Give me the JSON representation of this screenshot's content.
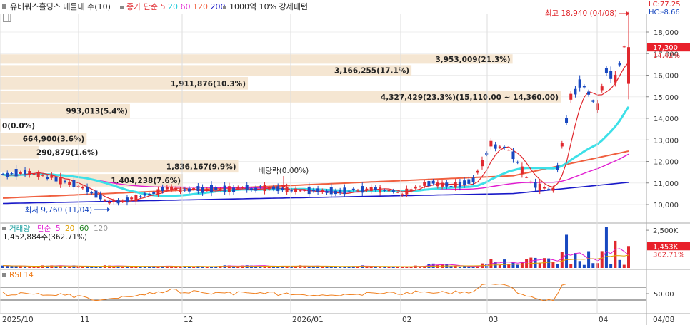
{
  "header": {
    "stock_name": "유비쿼스홀딩스 매물대 수(10)",
    "ma_label": "종가 단순",
    "ma_periods": [
      "5",
      "20",
      "60",
      "120",
      "200"
    ],
    "ma_colors": [
      "#e0282e",
      "#1ec9d8",
      "#e01ad0",
      "#f06040",
      "#1818c8"
    ],
    "volume_profile_label": "1000억 10% 강세패턴",
    "lc": "LC:77.25",
    "hc": "HC:-8.66"
  },
  "price_panel": {
    "high_label": "최고 18,940 (04/08)",
    "low_label": "최저 9,760 (11/04)",
    "dividend_label": "배당락(0.00%)",
    "last_price": "17,300",
    "last_change": "14.42%",
    "y_ticks": [
      "18,000",
      "17,000",
      "16,000",
      "15,000",
      "14,000",
      "13,000",
      "12,000",
      "11,000",
      "10,000"
    ]
  },
  "volume_profile": [
    {
      "label": "3,953,009(21.3%)",
      "low": 16500,
      "high": 17000,
      "pct": 21.3
    },
    {
      "label": "3,166,255(17.1%)",
      "low": 15950,
      "high": 16500,
      "pct": 17.1
    },
    {
      "label": "1,911,876(10.3%)",
      "low": 15300,
      "high": 15950,
      "pct": 10.3
    },
    {
      "label": "4,327,429(23.3%)(15,110.00 ~ 14,360.00)",
      "low": 14700,
      "high": 15300,
      "pct": 23.3
    },
    {
      "label": "993,013(5.4%)",
      "low": 14000,
      "high": 14700,
      "pct": 5.4
    },
    {
      "label": "0(0.0%)",
      "low": 13350,
      "high": 14000,
      "pct": 0.0
    },
    {
      "label": "664,900(3.6%)",
      "low": 12750,
      "high": 13350,
      "pct": 3.6
    },
    {
      "label": "290,879(1.6%)",
      "low": 12100,
      "high": 12750,
      "pct": 1.6
    },
    {
      "label": "1,836,167(9.9%)",
      "low": 11450,
      "high": 12100,
      "pct": 9.9
    },
    {
      "label": "1,404,238(7.6%)",
      "low": 10800,
      "high": 11450,
      "pct": 7.6
    }
  ],
  "volume_panel": {
    "label": "거래량",
    "ma_label": "단순",
    "ma_periods": [
      "5",
      "20",
      "60",
      "120"
    ],
    "ma_colors": [
      "#e01ad0",
      "#e0a000",
      "#208020",
      "#999999"
    ],
    "info": "1,452,884주(362.71%)",
    "y_tick": "2,500K",
    "last_volume": "1,453K",
    "last_change": "362.71%"
  },
  "rsi_panel": {
    "label": "RSI 14",
    "y_tick": "50.00"
  },
  "x_axis": {
    "labels": [
      "2025/10",
      "11",
      "12",
      "2026/01",
      "02",
      "03",
      "04",
      "04/08"
    ]
  },
  "colors": {
    "up": "#e0282e",
    "down": "#1848c0",
    "profile": "#f5e6d2",
    "price_tag": "#e8202a",
    "rsi": "#f08020"
  },
  "chart_data": {
    "type": "candlestick",
    "y_range": [
      9500,
      19100
    ],
    "close_points": [
      {
        "date": "2025/10",
        "close": 11200
      },
      {
        "date": "11/04",
        "close": 10100
      },
      {
        "date": "12",
        "close": 10700
      },
      {
        "date": "2026/01",
        "close": 10700
      },
      {
        "date": "02",
        "close": 10900
      },
      {
        "date": "02 late",
        "close": 12800
      },
      {
        "date": "03",
        "close": 10800
      },
      {
        "date": "03 mid",
        "close": 16000
      },
      {
        "date": "04",
        "close": 15900
      },
      {
        "date": "04/08",
        "close": 17300
      }
    ],
    "high": {
      "date": "04/08",
      "value": 18940
    },
    "low": {
      "date": "11/04",
      "value": 9760
    }
  }
}
